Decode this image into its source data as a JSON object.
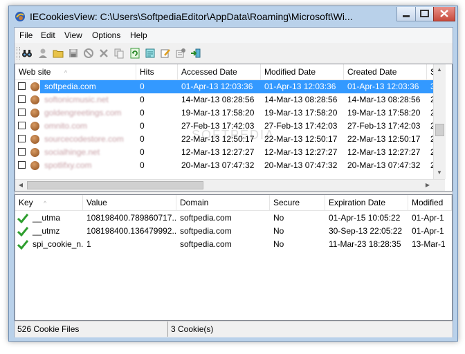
{
  "window": {
    "title": "IECookiesView:  C:\\Users\\SoftpediaEditor\\AppData\\Roaming\\Microsoft\\Wi...",
    "accent": "#b9d1ea",
    "close_color": "#c74a3c"
  },
  "menu": [
    "File",
    "Edit",
    "View",
    "Options",
    "Help"
  ],
  "toolbar": {
    "icons": [
      "find-icon",
      "user-icon",
      "open-folder-icon",
      "save-icon",
      "block-icon",
      "delete-icon",
      "copy-icon",
      "refresh-icon",
      "html-report-icon",
      "edit-icon",
      "properties-icon",
      "exit-icon"
    ]
  },
  "cookie_files": {
    "columns": [
      "Web site",
      "Hits",
      "Accessed Date",
      "Modified Date",
      "Created Date",
      "S"
    ],
    "sort_marker": "^",
    "rows": [
      {
        "site": "softpedia.com",
        "hits": "0",
        "accessed": "01-Apr-13 12:03:36",
        "modified": "01-Apr-13 12:03:36",
        "created": "01-Apr-13 12:03:36",
        "s": "3",
        "selected": true,
        "blurred": false
      },
      {
        "site": "softonicmusic.net",
        "hits": "0",
        "accessed": "14-Mar-13 08:28:56",
        "modified": "14-Mar-13 08:28:56",
        "created": "14-Mar-13 08:28:56",
        "s": "2",
        "selected": false,
        "blurred": true
      },
      {
        "site": "goldengreetings.com",
        "hits": "0",
        "accessed": "19-Mar-13 17:58:20",
        "modified": "19-Mar-13 17:58:20",
        "created": "19-Mar-13 17:58:20",
        "s": "2",
        "selected": false,
        "blurred": true
      },
      {
        "site": "omnito.com",
        "hits": "0",
        "accessed": "27-Feb-13 17:42:03",
        "modified": "27-Feb-13 17:42:03",
        "created": "27-Feb-13 17:42:03",
        "s": "2",
        "selected": false,
        "blurred": true
      },
      {
        "site": "sourcecodestore.com",
        "hits": "0",
        "accessed": "22-Mar-13 12:50:17",
        "modified": "22-Mar-13 12:50:17",
        "created": "22-Mar-13 12:50:17",
        "s": "2",
        "selected": false,
        "blurred": true
      },
      {
        "site": "socialhinge.net",
        "hits": "0",
        "accessed": "12-Mar-13 12:27:27",
        "modified": "12-Mar-13 12:27:27",
        "created": "12-Mar-13 12:27:27",
        "s": "2",
        "selected": false,
        "blurred": true
      },
      {
        "site": "spotlifxy.com",
        "hits": "0",
        "accessed": "20-Mar-13 07:47:32",
        "modified": "20-Mar-13 07:47:32",
        "created": "20-Mar-13 07:47:32",
        "s": "2",
        "selected": false,
        "blurred": true
      }
    ]
  },
  "cookies": {
    "columns": [
      "Key",
      "Value",
      "Domain",
      "Secure",
      "Expiration Date",
      "Modified"
    ],
    "sort_marker": "^",
    "rows": [
      {
        "key": "__utma",
        "value": "108198400.789860717....",
        "domain": "softpedia.com",
        "secure": "No",
        "expiration": "01-Apr-15 10:05:22",
        "modified": "01-Apr-1"
      },
      {
        "key": "__utmz",
        "value": "108198400.136479992....",
        "domain": "softpedia.com",
        "secure": "No",
        "expiration": "30-Sep-13 22:05:22",
        "modified": "01-Apr-1"
      },
      {
        "key": "spi_cookie_n...",
        "value": "1",
        "domain": "softpedia.com",
        "secure": "No",
        "expiration": "11-Mar-23 18:28:35",
        "modified": "13-Mar-1"
      }
    ]
  },
  "status": {
    "files": "526 Cookie Files",
    "cookies": "3 Cookie(s)"
  }
}
